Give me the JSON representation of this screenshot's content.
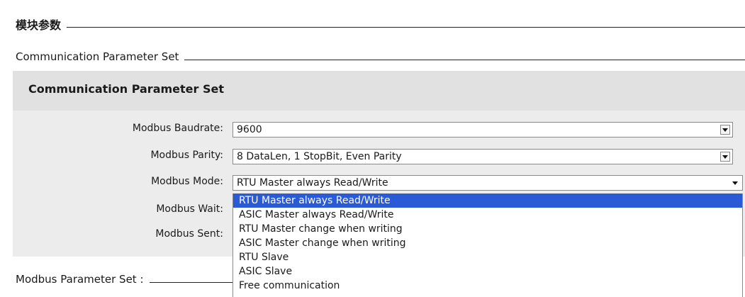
{
  "headers": {
    "module_params": "模块参数",
    "comm_param_set": "Communication Parameter Set",
    "modbus_param_set": "Modbus Parameter Set :"
  },
  "panel": {
    "title": "Communication Parameter Set"
  },
  "fields": {
    "baudrate": {
      "label": "Modbus Baudrate:",
      "value": "9600"
    },
    "parity": {
      "label": "Modbus Parity:",
      "value": "8 DataLen, 1 StopBit, Even Parity"
    },
    "mode": {
      "label": "Modbus Mode:",
      "value": "RTU Master always Read/Write"
    },
    "wait": {
      "label": "Modbus Wait:"
    },
    "sent": {
      "label": "Modbus Sent:"
    }
  },
  "mode_dropdown": {
    "options": [
      "RTU Master always Read/Write",
      "ASIC Master always Read/Write",
      "RTU Master change when writing",
      "ASIC Master change when writing",
      "RTU Slave",
      "ASIC Slave",
      "Free communication"
    ],
    "selected_index": 0
  },
  "icons": {
    "dropdown": "chevron-down-icon"
  },
  "colors": {
    "selection": "#2b5ad6",
    "panel_bg": "#ececec",
    "panel_title_bg": "#e1e1e1"
  }
}
